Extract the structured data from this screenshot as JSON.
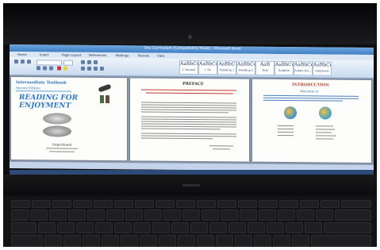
{
  "word_window": {
    "title": "Doc Curriculum [Compatibility Mode] - Microsoft Word",
    "tabs": [
      "Home",
      "Insert",
      "Page Layout",
      "References",
      "Mailings",
      "Review",
      "View"
    ],
    "styles": [
      {
        "sample": "AaBbCcDc",
        "name": "1 Normal"
      },
      {
        "sample": "AaBbCcDc",
        "name": "1 No Spaci..."
      },
      {
        "sample": "AaBbC",
        "name": "Heading 1"
      },
      {
        "sample": "AaBbCc",
        "name": "Heading 2"
      },
      {
        "sample": "AaB",
        "name": "Title"
      },
      {
        "sample": "AaBbCc.",
        "name": "Subtitle"
      },
      {
        "sample": "AaBbCcDc",
        "name": "Subtle Em..."
      },
      {
        "sample": "AaBbCcDc",
        "name": "Emphasis"
      }
    ]
  },
  "page_left": {
    "heading": "Intermediate Textbook",
    "subheading": "Second Edition",
    "title_line1": "READING FOR",
    "title_line2": "ENJOYMENT",
    "footer": "Department"
  },
  "page_middle": {
    "heading": "PREFACE"
  },
  "page_right": {
    "heading": "INTRODUCTION",
    "subheading": "Welcome to"
  },
  "accent_colors": {
    "left_heading": "#2a6fb8",
    "title_blue": "#2f78c9",
    "red_text": "#c23a2a",
    "intro_heading": "#c0402c"
  }
}
